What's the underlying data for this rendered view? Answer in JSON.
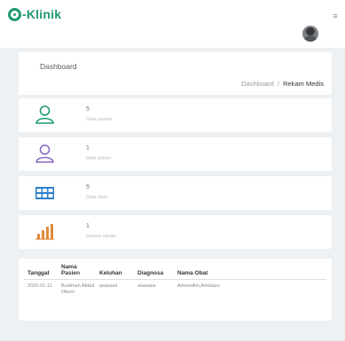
{
  "header": {
    "brand": "-Klinik",
    "menu_icon": "hamburger-icon",
    "avatar_icon": "user-avatar"
  },
  "breadcrumb": {
    "title": "Dashboard",
    "items": [
      "Dashboard",
      "Rekam Medis"
    ],
    "separator": "/"
  },
  "stats": [
    {
      "icon": "user-icon",
      "color": "#1f9a74",
      "value": "5",
      "label": "Data pasien"
    },
    {
      "icon": "user-icon",
      "color": "#8a6ac4",
      "value": "1",
      "label": "Data dokter"
    },
    {
      "icon": "table-icon",
      "color": "#2b7ec8",
      "value": "5",
      "label": "Data obat"
    },
    {
      "icon": "bar-chart-icon",
      "color": "#e08a3a",
      "value": "1",
      "label": "Rekam medis"
    }
  ],
  "table": {
    "columns": [
      "Tanggal",
      "Nama Pasien",
      "Keluhan",
      "Diagnosa",
      "Nama Obat"
    ],
    "rows": [
      [
        "2020-01-11",
        "Budiman Abdul Oboni",
        "asasasa",
        "asasasa",
        "Amoxsillin,Amidazo"
      ]
    ]
  },
  "colors": {
    "brand": "#1f9a74",
    "background": "#eef1f4"
  }
}
